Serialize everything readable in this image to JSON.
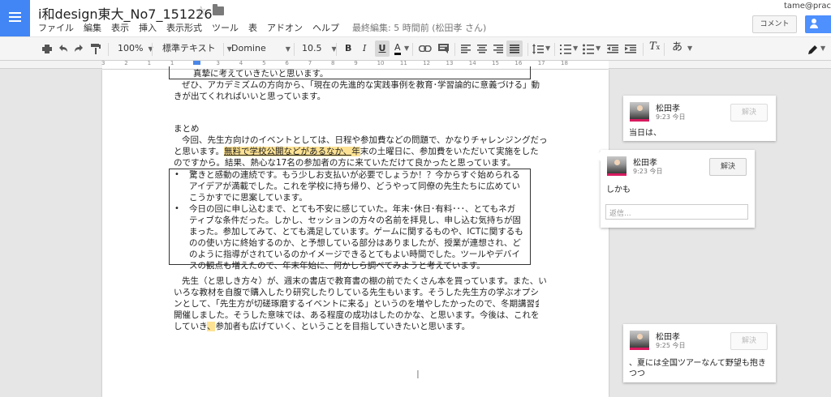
{
  "header": {
    "title": "i和design東大_No7_151226",
    "menu": [
      "ファイル",
      "編集",
      "表示",
      "挿入",
      "表示形式",
      "ツール",
      "表",
      "アドオン",
      "ヘルプ"
    ],
    "last_edit": "最終編集: 5 時間前 (松田孝 さん)",
    "user_email": "tame@prac",
    "comments_label": "コメント"
  },
  "toolbar": {
    "zoom": "100%",
    "style": "標準テキスト",
    "font": "Domine",
    "size": "10.5",
    "bold": "B",
    "italic": "I",
    "underline": "U",
    "text_color": "A",
    "input_tools": "あ"
  },
  "ruler": {
    "numbers": [
      "3",
      "2",
      "1",
      "1",
      "2",
      "3",
      "4",
      "5",
      "6",
      "7",
      "8",
      "9",
      "10",
      "11",
      "12",
      "13",
      "14",
      "15",
      "16",
      "17",
      "18"
    ]
  },
  "document": {
    "line_0": "真摯に考えていきたいと思います。",
    "line_1": "ぜひ、アカデミズムの方向から、「現在の先進的な実践事例を教育･学習論的に意義づける」動",
    "line_2": "きが出てくれればいいと思っています。",
    "heading": "まとめ",
    "s1_line1": "今回、先生方向けのイベントとしては、日程や参加費などの問題で、かなりチャレンジングだった",
    "s1_line2_a": "と思います。",
    "s1_line2_hl1": "無料で学校公開などがあるなか、",
    "s1_line2_hl2": "年",
    "s1_line2_b": "末の土曜日に、参加費をいただいて実施をした",
    "s1_line3": "のですから。結果、熱心な17名の参加者の方に来ていただけて良かったと思っています。",
    "bullet_1": "驚きと感動の連続です。もう少しお支払いが必要でしょうか！？今からすぐ始められるアイデアが満載でした。これを学校に持ち帰り、どうやって同僚の先生たちに広めていこうかすでに思案しています。",
    "bullet_2": "今日の回に申し込むまで、とても不安に感じていた。年末･休日･有料･･･、とてもネガティブな条件だった。しかし、セッションの方々の名前を拝見し、申し込む気持ちが固まった。参加してみて、とても満足しています。ゲームに関するものや、ICTに関するものの使い方に終始するのか、と予想している部分はありましたが、授業が連想され、どのように指導がされているのかイメージできるとてもよい時間でした。ツールやデバイスの観点も増えたので、年末年始に、何かしら調べてみようと考えています。",
    "bullet_mark": "•",
    "p2_line1": "先生（と思しき方々）が、週末の書店で教育書の棚の前でたくさん本を買っています。また、いろ",
    "p2_line2": "いろな教材を自腹で購入したり研究したりしている先生もいます。そうした先生方の学ぶオプショ",
    "p2_line3": "ンとして、「先生方が切磋琢磨するイベントに来る」というのを増やしたかったので、冬期講習会を",
    "p2_line4": "開催しました。そうした意味では、ある程度の成功はしたのかな、と思います。今後は、これを継続",
    "p2_line5_a": "していき",
    "p2_line5_hl": "、",
    "p2_line5_b": "参加者も広げていく、ということを目指していきたいと思います。"
  },
  "comments": [
    {
      "author": "松田孝",
      "time": "9:23 今日",
      "text": "当日は、",
      "resolve": "解決"
    },
    {
      "author": "松田孝",
      "time": "9:23 今日",
      "text": "しかも",
      "resolve": "解決",
      "reply_placeholder": "返信..."
    },
    {
      "author": "松田孝",
      "time": "9:25 今日",
      "text": "、夏には全国ツアーなんて野望も抱きつつ",
      "resolve": "解決"
    }
  ],
  "colors": {
    "accent": "#4285f4",
    "highlight": "#fde293",
    "share": "#4d90fe",
    "avatar_stripe": "#d81b60"
  }
}
